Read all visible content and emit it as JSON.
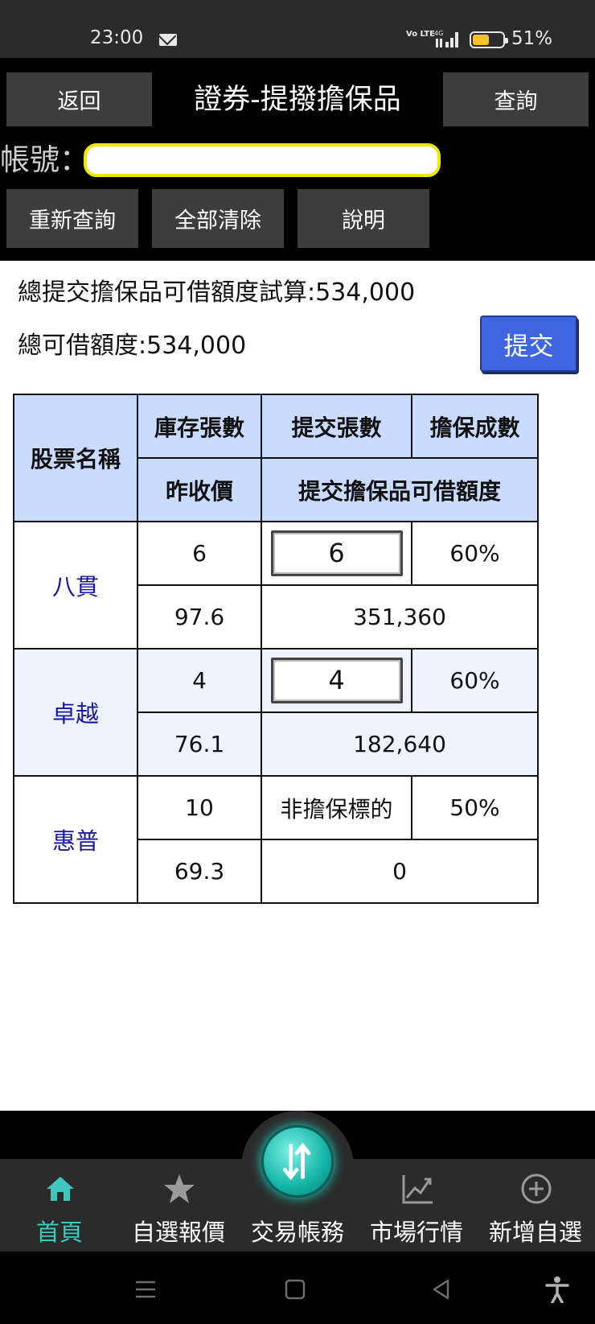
{
  "status_bar": {
    "time": "23:00",
    "battery": "51%",
    "network": "4G",
    "volte": "Vo LTE"
  },
  "header": {
    "back_label": "返回",
    "title": "證券-提撥擔保品",
    "query_label": "查詢",
    "account_label": "帳號：",
    "account_value": "",
    "requery_label": "重新查詢",
    "clear_label": "全部清除",
    "help_label": "說明"
  },
  "summary": {
    "total_submit_credit": "總提交擔保品可借額度試算:534,000",
    "total_credit": "總可借額度:534,000",
    "submit_label": "提交"
  },
  "table": {
    "headers": {
      "stock_name": "股票名稱",
      "inventory": "庫存張數",
      "submit_qty": "提交張數",
      "collateral_ratio": "擔保成數",
      "prev_close": "昨收價",
      "credit": "提交擔保品可借額度"
    },
    "rows": [
      {
        "name": "八貫",
        "inventory": "6",
        "submit_qty": "6",
        "ratio": "60%",
        "prev_close": "97.6",
        "credit": "351,360"
      },
      {
        "name": "卓越",
        "inventory": "4",
        "submit_qty": "4",
        "ratio": "60%",
        "prev_close": "76.1",
        "credit": "182,640"
      },
      {
        "name": "惠普",
        "inventory": "10",
        "submit_qty": "非擔保標的",
        "ratio": "50%",
        "prev_close": "69.3",
        "credit": "0"
      }
    ]
  },
  "bottom_nav": {
    "items": [
      {
        "label": "首頁",
        "icon": "home-icon",
        "active": true
      },
      {
        "label": "自選報價",
        "icon": "star-icon"
      },
      {
        "label": "交易帳務",
        "icon": "transfer-icon"
      },
      {
        "label": "市場行情",
        "icon": "chart-icon"
      },
      {
        "label": "新增自選",
        "icon": "plus-circle-icon"
      }
    ]
  },
  "colors": {
    "accent": "#3ec7bf",
    "submit": "#3f65e2",
    "header_cell": "#c9dbff",
    "stock_name": "#1818a8",
    "account_border": "#f0e800"
  }
}
